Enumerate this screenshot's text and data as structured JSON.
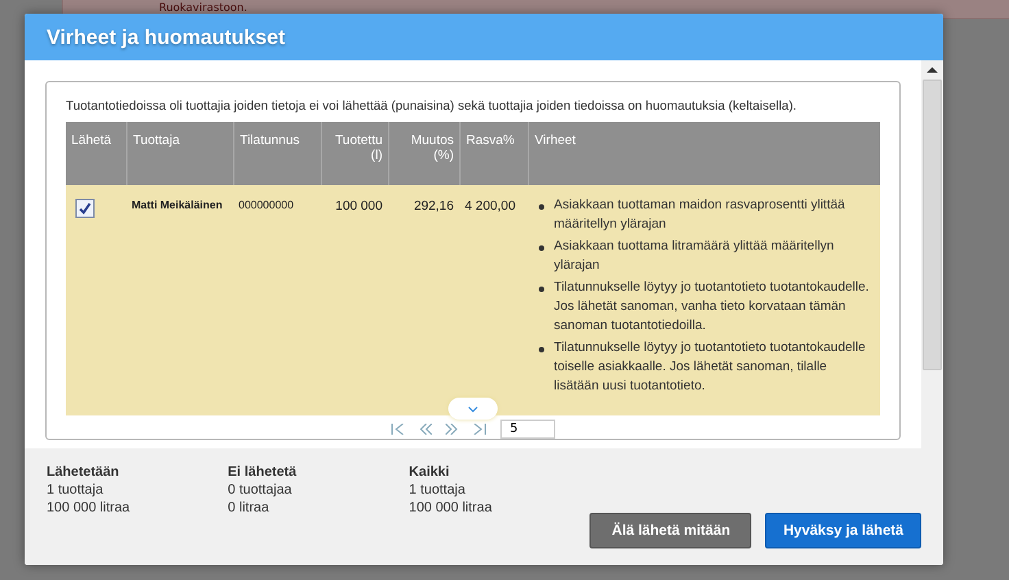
{
  "background_text": "Ruokavirastoon.",
  "dialog": {
    "title": "Virheet ja huomautukset",
    "intro": "Tuotantotiedoissa oli tuottajia joiden tietoja ei voi lähettää (punaisina) sekä tuottajia joiden tiedoissa on huomautuksia (keltaisella).",
    "table": {
      "columns": [
        "Lähetä",
        "Tuottaja",
        "Tilatunnus",
        "Tuotettu (l)",
        "Muutos (%)",
        "Rasva%",
        "Virheet"
      ],
      "rows": [
        {
          "send": true,
          "color": "#f0e4b0",
          "producer": "Matti Meikäläinen",
          "farm_id": "000000000",
          "produced": "100 000",
          "change": "292,16",
          "fat": "4 200,00",
          "errors": [
            "Asiakkaan tuottaman maidon rasvaprosentti ylittää määritellyn ylärajan",
            "Asiakkaan tuottama litramäärä ylittää määritellyn ylärajan",
            "Tilatunnukselle löytyy jo tuotantotieto tuotantokaudelle. Jos lähetät sanoman, vanha tieto korvataan tämän sanoman tuotantotiedoilla.",
            "Tilatunnukselle löytyy jo tuotantotieto tuotantokaudelle toiselle asiakkaalle. Jos lähetät sanoman, tilalle lisätään uusi tuotantotieto."
          ]
        }
      ]
    },
    "page_size": "5",
    "summary": [
      {
        "title": "Lähetetään",
        "producers": "1 tuottaja",
        "litres": "100 000 litraa"
      },
      {
        "title": "Ei lähetetä",
        "producers": "0 tuottajaa",
        "litres": "0 litraa"
      },
      {
        "title": "Kaikki",
        "producers": "1 tuottaja",
        "litres": "100 000 litraa"
      }
    ],
    "buttons": [
      {
        "label": "Älä lähetä mitään",
        "kind": "secondary"
      },
      {
        "label": "Hyväksy ja lähetä",
        "kind": "primary"
      }
    ]
  }
}
